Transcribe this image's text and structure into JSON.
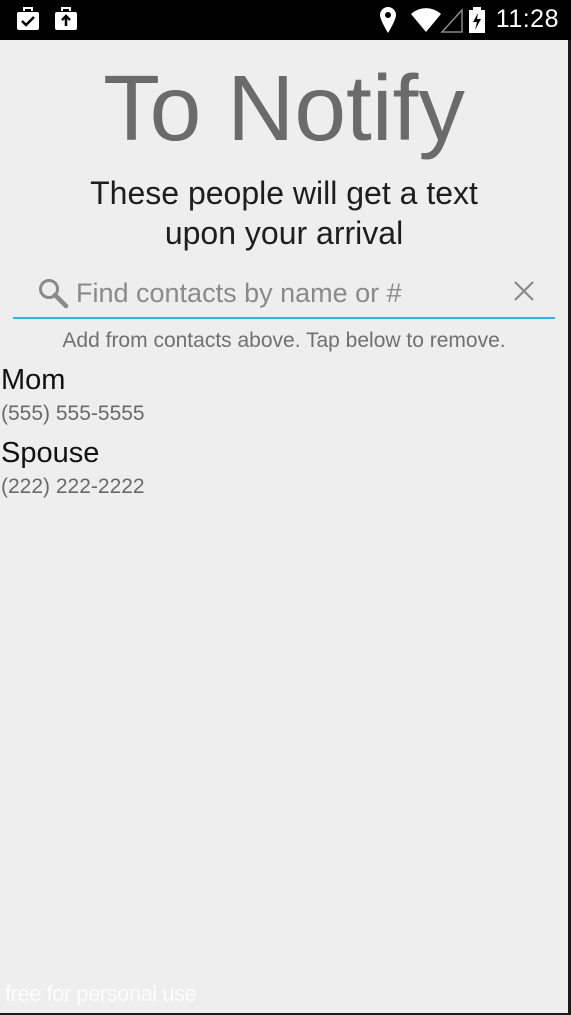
{
  "status_bar": {
    "time": "11:28",
    "icons": [
      "briefcase-check-icon",
      "briefcase-upload-icon",
      "location-pin-icon",
      "wifi-icon",
      "cell-signal-icon",
      "battery-charging-icon"
    ]
  },
  "header": {
    "title": "To Notify",
    "subtitle_line1": "These people will get a text",
    "subtitle_line2": "upon your arrival"
  },
  "search": {
    "placeholder": "Find contacts by name or #",
    "value": "",
    "accent_color": "#33b5e5"
  },
  "hint": "Add from contacts above. Tap below to remove.",
  "contacts": [
    {
      "name": "Mom",
      "phone": "(555) 555-5555"
    },
    {
      "name": "Spouse",
      "phone": "(222) 222-2222"
    }
  ],
  "watermark": "free for personal use",
  "colors": {
    "background": "#eeeeee",
    "title": "#6b6b6b",
    "status_bar": "#000000"
  }
}
